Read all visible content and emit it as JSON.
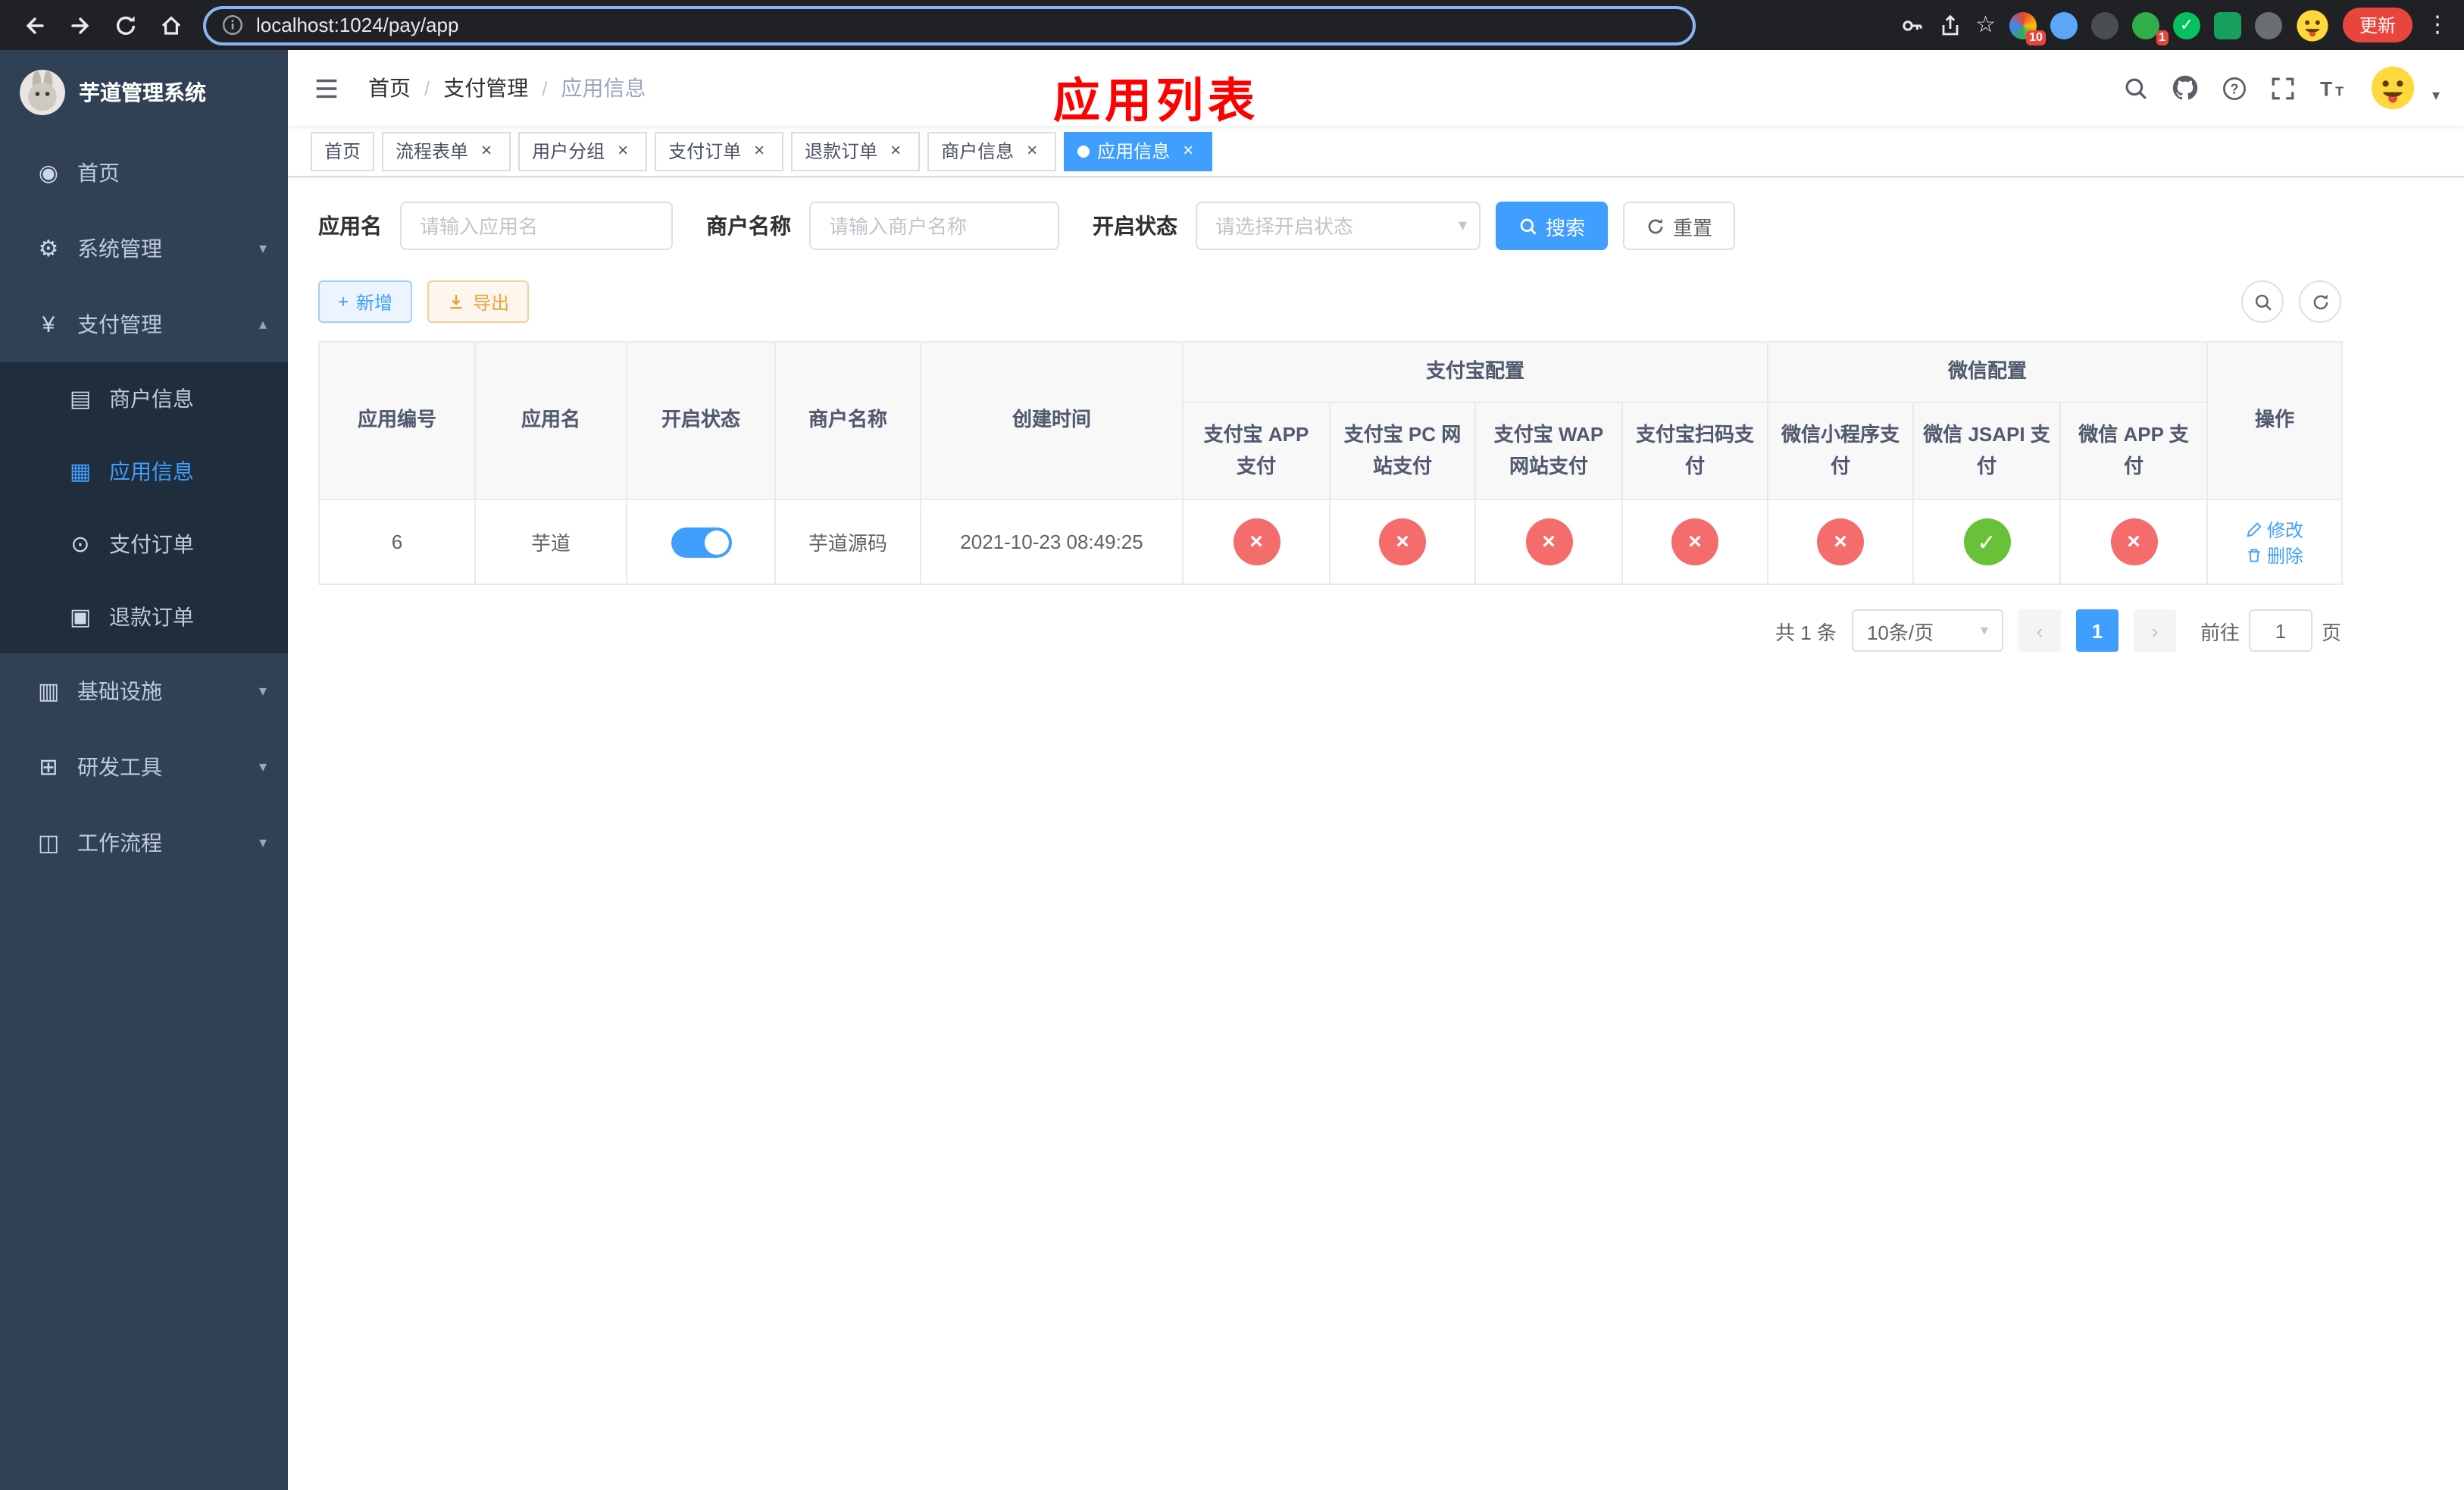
{
  "browser": {
    "url": "localhost:1024/pay/app",
    "update_label": "更新",
    "extension_badge_count": "10",
    "profile_badge_count": "1"
  },
  "sidebar": {
    "title": "芋道管理系统",
    "items": [
      {
        "label": "首页",
        "icon": "dashboard-icon",
        "glyph": "◉",
        "expandable": false
      },
      {
        "label": "系统管理",
        "icon": "gear-icon",
        "glyph": "⚙",
        "expandable": true,
        "expanded": false
      },
      {
        "label": "支付管理",
        "icon": "yen-icon",
        "glyph": "¥",
        "expandable": true,
        "expanded": true,
        "children": [
          {
            "label": "商户信息",
            "icon": "merchant-card-icon",
            "glyph": "▤",
            "active": false
          },
          {
            "label": "应用信息",
            "icon": "app-grid-icon",
            "glyph": "▦",
            "active": true
          },
          {
            "label": "支付订单",
            "icon": "pay-order-icon",
            "glyph": "⊙",
            "active": false
          },
          {
            "label": "退款订单",
            "icon": "refund-order-icon",
            "glyph": "▣",
            "active": false
          }
        ]
      },
      {
        "label": "基础设施",
        "icon": "infrastructure-icon",
        "glyph": "▥",
        "expandable": true,
        "expanded": false
      },
      {
        "label": "研发工具",
        "icon": "dev-tools-icon",
        "glyph": "⊞",
        "expandable": true,
        "expanded": false
      },
      {
        "label": "工作流程",
        "icon": "workflow-icon",
        "glyph": "◫",
        "expandable": true,
        "expanded": false
      }
    ]
  },
  "header": {
    "breadcrumb": [
      "首页",
      "支付管理",
      "应用信息"
    ],
    "overlay_title": "应用列表"
  },
  "tabs": [
    {
      "label": "首页",
      "closable": false,
      "active": false
    },
    {
      "label": "流程表单",
      "closable": true,
      "active": false
    },
    {
      "label": "用户分组",
      "closable": true,
      "active": false
    },
    {
      "label": "支付订单",
      "closable": true,
      "active": false
    },
    {
      "label": "退款订单",
      "closable": true,
      "active": false
    },
    {
      "label": "商户信息",
      "closable": true,
      "active": false
    },
    {
      "label": "应用信息",
      "closable": true,
      "active": true
    }
  ],
  "filters": {
    "app_name_label": "应用名",
    "app_name_placeholder": "请输入应用名",
    "merchant_label": "商户名称",
    "merchant_placeholder": "请输入商户名称",
    "status_label": "开启状态",
    "status_placeholder": "请选择开启状态",
    "search_label": "搜索",
    "reset_label": "重置"
  },
  "toolbar": {
    "add_label": "新增",
    "export_label": "导出"
  },
  "table": {
    "header": {
      "left": [
        "应用编号",
        "应用名",
        "开启状态",
        "商户名称",
        "创建时间"
      ],
      "groups": [
        {
          "label": "支付宝配置",
          "children": [
            "支付宝 APP 支付",
            "支付宝 PC 网站支付",
            "支付宝 WAP 网站支付",
            "支付宝扫码支付"
          ]
        },
        {
          "label": "微信配置",
          "children": [
            "微信小程序支付",
            "微信 JSAPI 支付",
            "微信 APP 支付"
          ]
        }
      ],
      "right": [
        "操作"
      ]
    },
    "rows": [
      {
        "id": "6",
        "app_name": "芋道",
        "enabled": true,
        "merchant_name": "芋道源码",
        "created_at": "2021-10-23 08:49:25",
        "statuses": [
          "fail",
          "fail",
          "fail",
          "fail",
          "fail",
          "success",
          "fail"
        ],
        "edit_label": "修改",
        "delete_label": "删除"
      }
    ]
  },
  "pagination": {
    "total_text": "共 1 条",
    "page_size": "10条/页",
    "current_page": "1",
    "goto_prefix": "前往",
    "goto_value": "1",
    "goto_suffix": "页"
  },
  "glyphs": {
    "check": "✓",
    "cross": "×",
    "close": "×",
    "caret_down": "▾",
    "chevron_up": "▴",
    "chevron_down": "▾",
    "prev": "‹",
    "next": "›",
    "plus": "+",
    "slash": "/",
    "dots": "⋮",
    "star": "☆"
  },
  "colors": {
    "primary": "#409eff",
    "success": "#67c23a",
    "danger": "#f56c6c",
    "warning": "#e6a23c",
    "overlay_red": "#fe0000",
    "sidebar_bg": "#304156",
    "submenu_bg": "#1f2d3d",
    "update_red": "#e8453c",
    "table_header_bg": "#f8f8f9",
    "chrome_bg": "#202124",
    "omnibox_focus": "#8ab4f8"
  }
}
